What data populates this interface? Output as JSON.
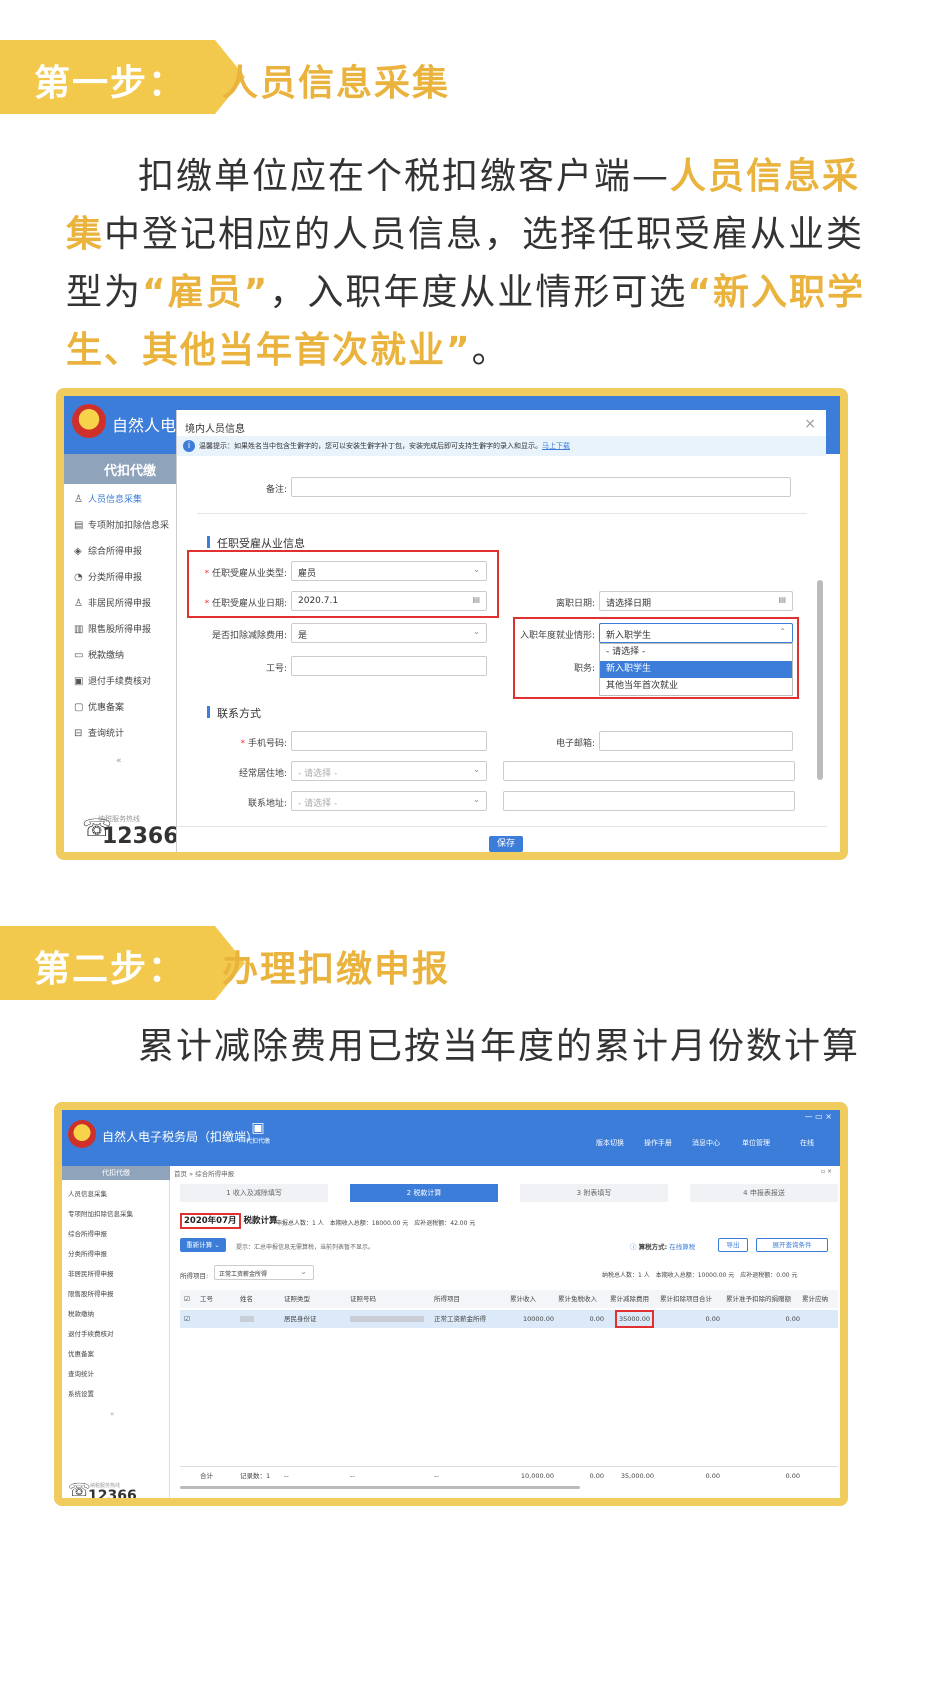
{
  "step1": {
    "tag": "第一步：",
    "title": "人员信息采集",
    "para_parts": [
      {
        "t": "扣缴单位应在个税扣缴客户端—",
        "h": false
      },
      {
        "t": "人员信息采集",
        "h": true
      },
      {
        "t": "中登记相应的人员信息，选择任职受雇从业类型为",
        "h": false
      },
      {
        "t": "“雇员”",
        "h": true
      },
      {
        "t": "，入职年度从业情形可选",
        "h": false
      },
      {
        "t": "“新入职学生、其他当年首次就业”",
        "h": true
      },
      {
        "t": "。",
        "h": false
      }
    ]
  },
  "shot1": {
    "app_name": "自然人电子",
    "agent_tab": "代扣代缴",
    "menu": [
      "人员信息采集",
      "专项附加扣除信息采",
      "综合所得申报",
      "分类所得申报",
      "非居民所得申报",
      "限售股所得申报",
      "税款缴纳",
      "退付手续费核对",
      "优惠备案",
      "查询统计"
    ],
    "menu_icons": [
      "♙",
      "▤",
      "◈",
      "◔",
      "♙",
      "▥",
      "▭",
      "▣",
      "▢",
      "⊟"
    ],
    "hotline_label": "纳税服务热线",
    "hotline": "12366",
    "modal": {
      "title": "境内人员信息",
      "notice": "温馨提示：如果姓名当中包含生僻字的，您可以安装生僻字补丁包，安装完成后即可支持生僻字的录入和显示。",
      "notice_link": "马上下载",
      "remark_label": "备注:",
      "section1": "任职受雇从业信息",
      "emp_type_label": "任职受雇从业类型:",
      "emp_type_value": "雇员",
      "emp_date_label": "任职受雇从业日期:",
      "emp_date_value": "2020.7.1",
      "leave_label": "离职日期:",
      "leave_ph": "请选择日期",
      "deduct_label": "是否扣除减除费用:",
      "deduct_value": "是",
      "situation_label": "入职年度就业情形:",
      "situation_value": "新入职学生",
      "situation_options": [
        "- 请选择 -",
        "新入职学生",
        "其他当年首次就业"
      ],
      "job_no_label": "工号:",
      "duty_label": "职务:",
      "section2": "联系方式",
      "phone_label": "手机号码:",
      "email_label": "电子邮箱:",
      "residence_label": "经常居住地:",
      "residence_ph": "- 请选择 -",
      "address_label": "联系地址:",
      "address_ph": "- 请选择 -",
      "save": "保存"
    }
  },
  "step2": {
    "tag": "第二步：",
    "title": "办理扣缴申报",
    "para": "累计减除费用已按当年度的累计月份数计算"
  },
  "shot2": {
    "app_name": "自然人电子税务局（扣缴端）",
    "agent_btn": "代扣代缴",
    "top_btns": [
      "版本切换",
      "操作手册",
      "消息中心",
      "单位管理",
      "在线"
    ],
    "agent_tab": "代扣代缴",
    "menu": [
      "人员信息采集",
      "专项附加扣除信息采集",
      "综合所得申报",
      "分类所得申报",
      "非居民所得申报",
      "限售股所得申报",
      "税款缴纳",
      "退付手续费核对",
      "优惠备案",
      "查询统计",
      "系统设置"
    ],
    "breadcrumb": "首页 » 综合所得申报",
    "steps": [
      "1 收入及减除填写",
      "2 税款计算",
      "3 附表填写",
      "4 申报表报送"
    ],
    "period": "2020年07月",
    "calc_title": "税款计算",
    "summary": "申报总人数：1 人　本期收入总额：18000.00 元　应补退税额：42.00 元",
    "recalc": "重新计算",
    "tip": "提示：汇总申报信息无需算税，当前列表暂不显示。",
    "calc_mode_label": "算税方式:",
    "calc_mode_value": "在线算税",
    "export": "导出",
    "expand": "展开查询条件",
    "income_item_label": "所得项目:",
    "income_item_value": "正常工资薪金所得",
    "totals": "纳税总人数：1 人　本期收入总额：10000.00 元　应补退税额：0.00 元",
    "columns": [
      "工号",
      "姓名",
      "证照类型",
      "证照号码",
      "所得项目",
      "累计收入",
      "累计免税收入",
      "累计减除费用",
      "累计扣除项目合计",
      "累计准予扣除的捐赠额",
      "累计应纳"
    ],
    "row": {
      "id_type": "居民身份证",
      "item": "正常工资薪金所得",
      "income": "10000.00",
      "exempt": "0.00",
      "deduction": "35000.00",
      "items_total": "0.00",
      "donation": "0.00"
    },
    "sum_row": {
      "label": "合计",
      "count": "记录数：1",
      "dash1": "--",
      "dash2": "--",
      "dash3": "--",
      "income": "10,000.00",
      "exempt": "0.00",
      "deduction": "35,000.00",
      "items_total": "0.00",
      "donation": "0.00"
    },
    "hotline": "12366",
    "hotline_label": "纳税服务热线"
  }
}
